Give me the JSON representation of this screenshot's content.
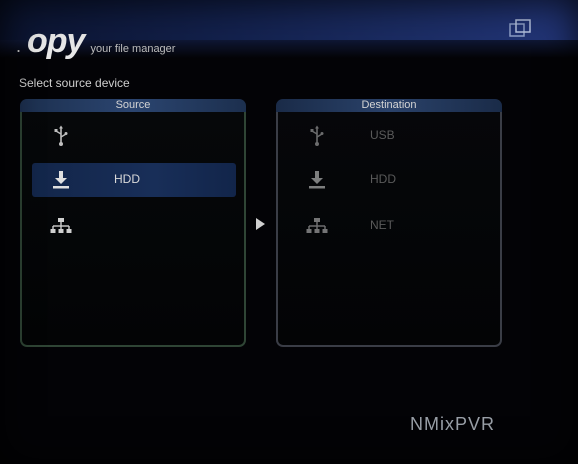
{
  "app": {
    "logo_text": "opy",
    "tagline": "your file manager",
    "brand": "NMixPVR"
  },
  "instruction": "Select source device",
  "source_panel": {
    "title": "Source",
    "items": [
      {
        "icon": "usb-icon",
        "label": ""
      },
      {
        "icon": "hdd-download-icon",
        "label": "HDD",
        "selected": true
      },
      {
        "icon": "network-icon",
        "label": ""
      }
    ]
  },
  "destination_panel": {
    "title": "Destination",
    "items": [
      {
        "icon": "usb-icon",
        "label": "USB"
      },
      {
        "icon": "hdd-download-icon",
        "label": "HDD"
      },
      {
        "icon": "network-icon",
        "label": "NET"
      }
    ]
  },
  "colors": {
    "top_band": "#1b2c63",
    "selection": "#182e58",
    "source_border": "#2f4535",
    "dest_border": "#3a3d46"
  }
}
